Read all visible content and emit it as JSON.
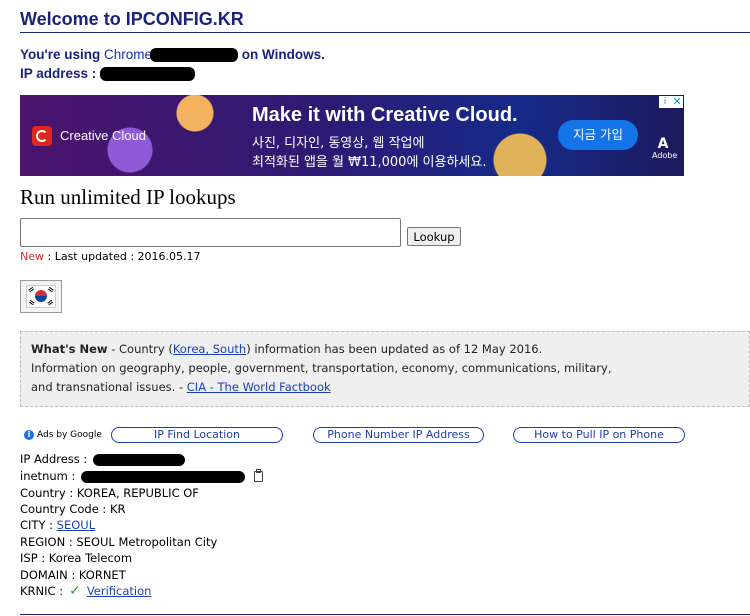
{
  "header": {
    "title": "Welcome to IPCONFIG.KR"
  },
  "user": {
    "using_prefix": "You're using",
    "browser": "Chrome",
    "on_windows": "on Windows.",
    "ip_label": "IP address :"
  },
  "ad_banner": {
    "brand": "Creative Cloud",
    "headline": "Make it with Creative Cloud.",
    "line1": "사진, 디자인, 동영상, 웹 작업에",
    "line2": "최적화된 앱을 월 ₩11,000에 이용하세요.",
    "cta": "지금 가입",
    "adobe_label": "Adobe",
    "brand_color": "#e0271c",
    "cta_color": "#1473e6"
  },
  "lookup": {
    "title": "Run unlimited IP lookups",
    "input_value": "",
    "button": "Lookup",
    "new_label": "New",
    "updated_text": " : Last updated : 2016.05.17"
  },
  "news": {
    "label": "What's New",
    "p1": " - Country (",
    "country_link": "Korea, South",
    "p2": ") information has been updated as of 12 May 2016.",
    "line2": "Information on geography, people, government, transportation, economy, communications, military,",
    "line3_prefix": "and transnational issues. - ",
    "source_link": "CIA - The World Factbook"
  },
  "ad_links": {
    "ads_by": "Ads by Google",
    "items": [
      "IP Find Location",
      "Phone Number IP Address",
      "How to Pull IP on Phone"
    ]
  },
  "info": {
    "ip_address": "IP Address :",
    "inetnum": "inetnum :",
    "country": "Country : KOREA, REPUBLIC OF",
    "country_code": "Country Code : KR",
    "city_label": "CITY : ",
    "city": "SEOUL",
    "region": "REGION : SEOUL Metropolitan City",
    "isp": "ISP : Korea Telecom",
    "domain": "DOMAIN : KORNET",
    "krnic_label": "KRNIC :",
    "verification": "Verification"
  },
  "icons": {
    "flag": "south-korea-flag-icon",
    "clipboard": "clipboard-icon",
    "check": "checkmark-icon"
  }
}
